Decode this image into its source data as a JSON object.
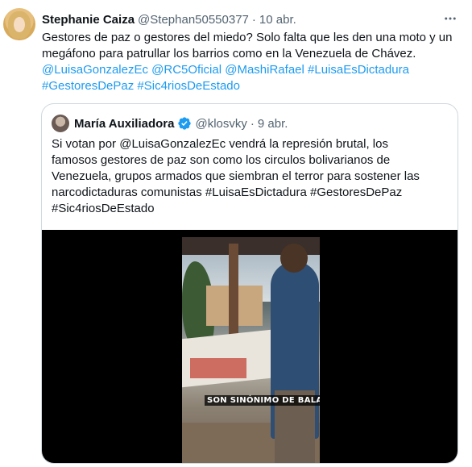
{
  "tweet": {
    "display_name": "Stephanie Caiza",
    "handle": "@Stephan50550377",
    "separator": "·",
    "date": "10 abr.",
    "more_icon": "more-horizontal-icon",
    "text_line1": "Gestores de paz o gestores del miedo? Solo falta que les den una moto y un",
    "text_line2": "megáfono para patrullar los barrios como en la Venezuela de Chávez.",
    "mentions": [
      "@LuisaGonzalezEc",
      "@RC5Oficial",
      "@MashiRafael"
    ],
    "hashtags": [
      "#LuisaEsDictadura",
      "#GestoresDePaz",
      "#Sic4riosDeEstado"
    ]
  },
  "quote": {
    "display_name": "María Auxiliadora",
    "verified_icon": "verified-badge-icon",
    "handle": "@klosvky",
    "separator": "·",
    "date": "9 abr.",
    "text_line1": "Si votan por @LuisaGonzalezEc vendrá la represión brutal, los",
    "text_line2": "famosos gestores de paz son como los circulos bolivarianos de",
    "text_line3": "Venezuela, grupos armados que siembran el terror para sostener las",
    "text_line4": "narcodictaduras comunistas #LuisaEsDictadura #GestoresDePaz",
    "text_line5": "#Sic4riosDeEstado",
    "video_caption": "SON SINÓNIMO DE BALAS"
  },
  "colors": {
    "link": "#1d9bf0",
    "text": "#0f1419",
    "secondary": "#536471",
    "border": "#cfd9de"
  }
}
